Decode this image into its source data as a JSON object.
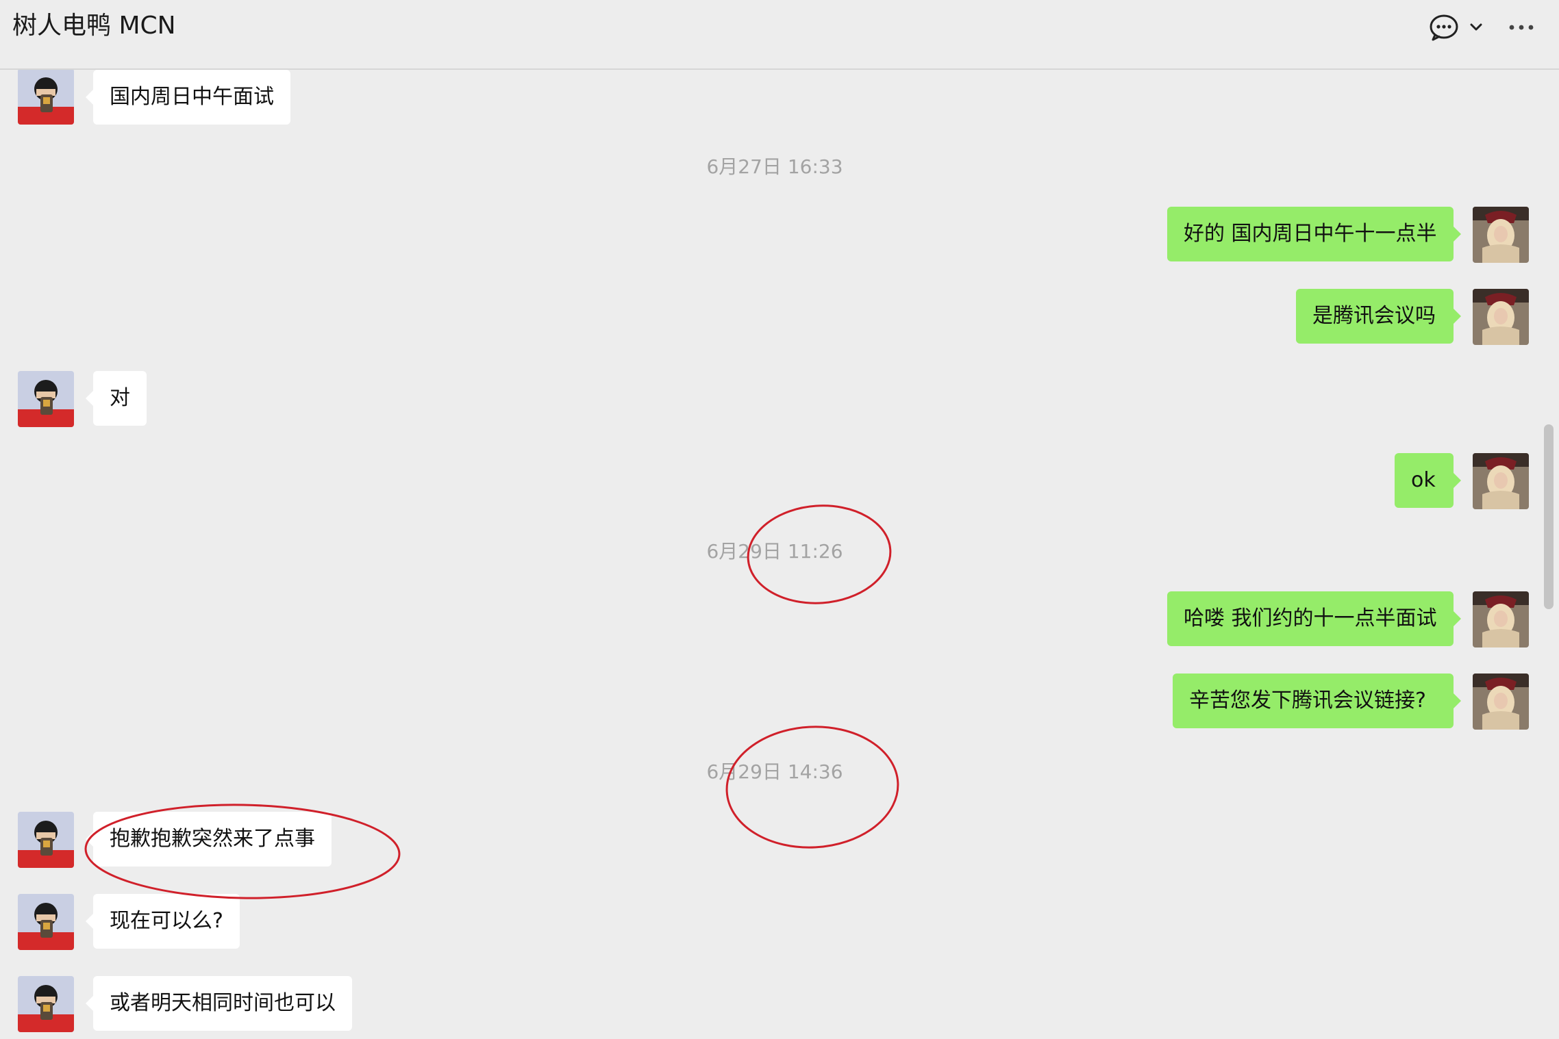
{
  "header": {
    "title": "树人电鸭 MCN",
    "icons": [
      "chat-bubble-icon",
      "chevron-down-icon",
      "more-icon"
    ]
  },
  "colors": {
    "background": "#ededed",
    "incoming_bubble": "#ffffff",
    "outgoing_bubble": "#95ec69",
    "timestamp_text": "#a3a3a3",
    "annotation_circle": "#d0202a"
  },
  "messages": [
    {
      "side": "in",
      "text": "国内周日中午面试"
    },
    {
      "side": "time",
      "text": "6月27日 16:33"
    },
    {
      "side": "out",
      "text": "好的 国内周日中午十一点半"
    },
    {
      "side": "out",
      "text": "是腾讯会议吗"
    },
    {
      "side": "in",
      "text": "对"
    },
    {
      "side": "out",
      "text": "ok"
    },
    {
      "side": "time",
      "text": "6月29日 11:26"
    },
    {
      "side": "out",
      "text": "哈喽 我们约的十一点半面试"
    },
    {
      "side": "out",
      "text": "辛苦您发下腾讯会议链接?"
    },
    {
      "side": "time",
      "text": "6月29日 14:36"
    },
    {
      "side": "in",
      "text": "抱歉抱歉突然来了点事"
    },
    {
      "side": "in",
      "text": "现在可以么?"
    },
    {
      "side": "in",
      "text": "或者明天相同时间也可以"
    }
  ]
}
